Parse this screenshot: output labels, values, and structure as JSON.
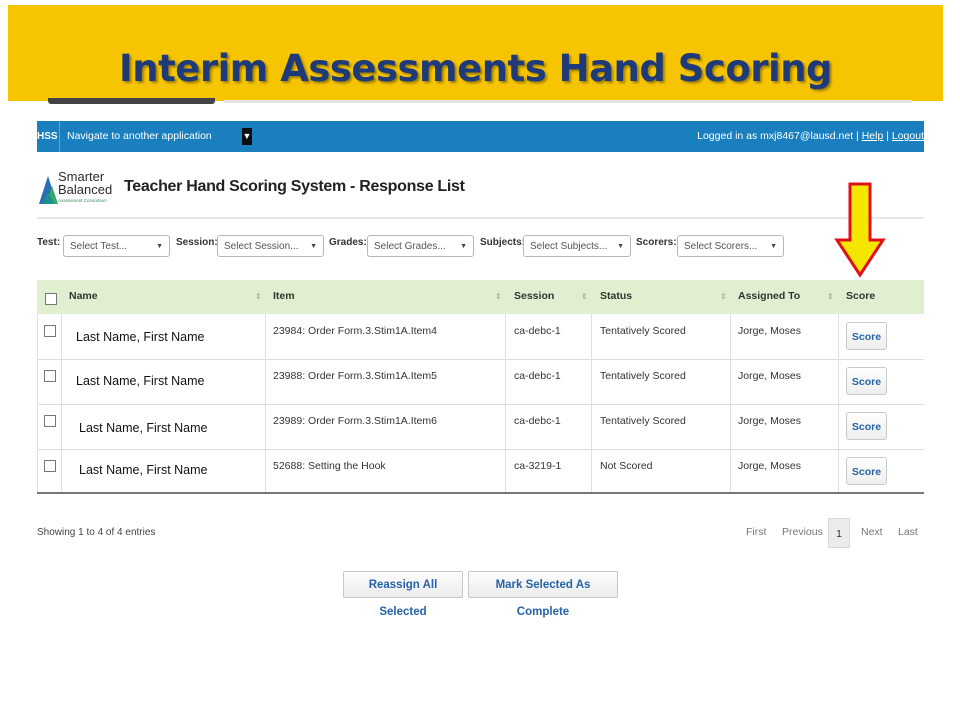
{
  "slide": {
    "title": "Interim Assessments Hand Scoring"
  },
  "topbar": {
    "brand": "HSS",
    "nav_label": "Navigate to another application",
    "logged_in_text": "Logged in as mxj8467@lausd.net | ",
    "help": "Help",
    "separator": " | ",
    "logout": "Logout"
  },
  "header": {
    "logo_line1": "Smarter",
    "logo_line2": "Balanced",
    "logo_line3": "Assessment Consortium",
    "title": "Teacher Hand Scoring System - Response List"
  },
  "filters": [
    {
      "label": "Test:",
      "value": "Select Test..."
    },
    {
      "label": "Session:",
      "value": "Select Session..."
    },
    {
      "label": "Grades:",
      "value": "Select Grades..."
    },
    {
      "label": "Subjects:",
      "value": "Select Subjects..."
    },
    {
      "label": "Scorers:",
      "value": "Select Scorers..."
    }
  ],
  "table": {
    "columns": [
      "Name",
      "Item",
      "Session",
      "Status",
      "Assigned To",
      "Score"
    ],
    "rows": [
      {
        "name": "Last Name, First Name",
        "item": "23984: Order Form.3.Stim1A.Item4",
        "session": "ca-debc-1",
        "status": "Tentatively Scored",
        "assigned_to": "Jorge, Moses",
        "action": "Score"
      },
      {
        "name": "Last Name, First Name",
        "item": "23988: Order Form.3.Stim1A.Item5",
        "session": "ca-debc-1",
        "status": "Tentatively Scored",
        "assigned_to": "Jorge, Moses",
        "action": "Score"
      },
      {
        "name": "Last Name, First Name",
        "item": "23989: Order Form.3.Stim1A.Item6",
        "session": "ca-debc-1",
        "status": "Tentatively Scored",
        "assigned_to": "Jorge, Moses",
        "action": "Score"
      },
      {
        "name": "Last Name, First Name",
        "item": "52688: Setting the Hook",
        "session": "ca-3219-1",
        "status": "Not Scored",
        "assigned_to": "Jorge, Moses",
        "action": "Score"
      }
    ]
  },
  "footer": {
    "showing": "Showing 1 to 4 of 4 entries",
    "pagination": {
      "first": "First",
      "previous": "Previous",
      "current": "1",
      "next": "Next",
      "last": "Last"
    },
    "reassign_label": "Reassign All Selected",
    "complete_label": "Mark Selected As Complete"
  },
  "colors": {
    "banner": "#f6c400",
    "banner_title": "#1e3a7a",
    "topbar": "#1a7fbe",
    "table_header": "#dfefcf",
    "link_blue": "#2463a8",
    "arrow_fill": "#f5e600",
    "arrow_outline": "#e0101a"
  }
}
